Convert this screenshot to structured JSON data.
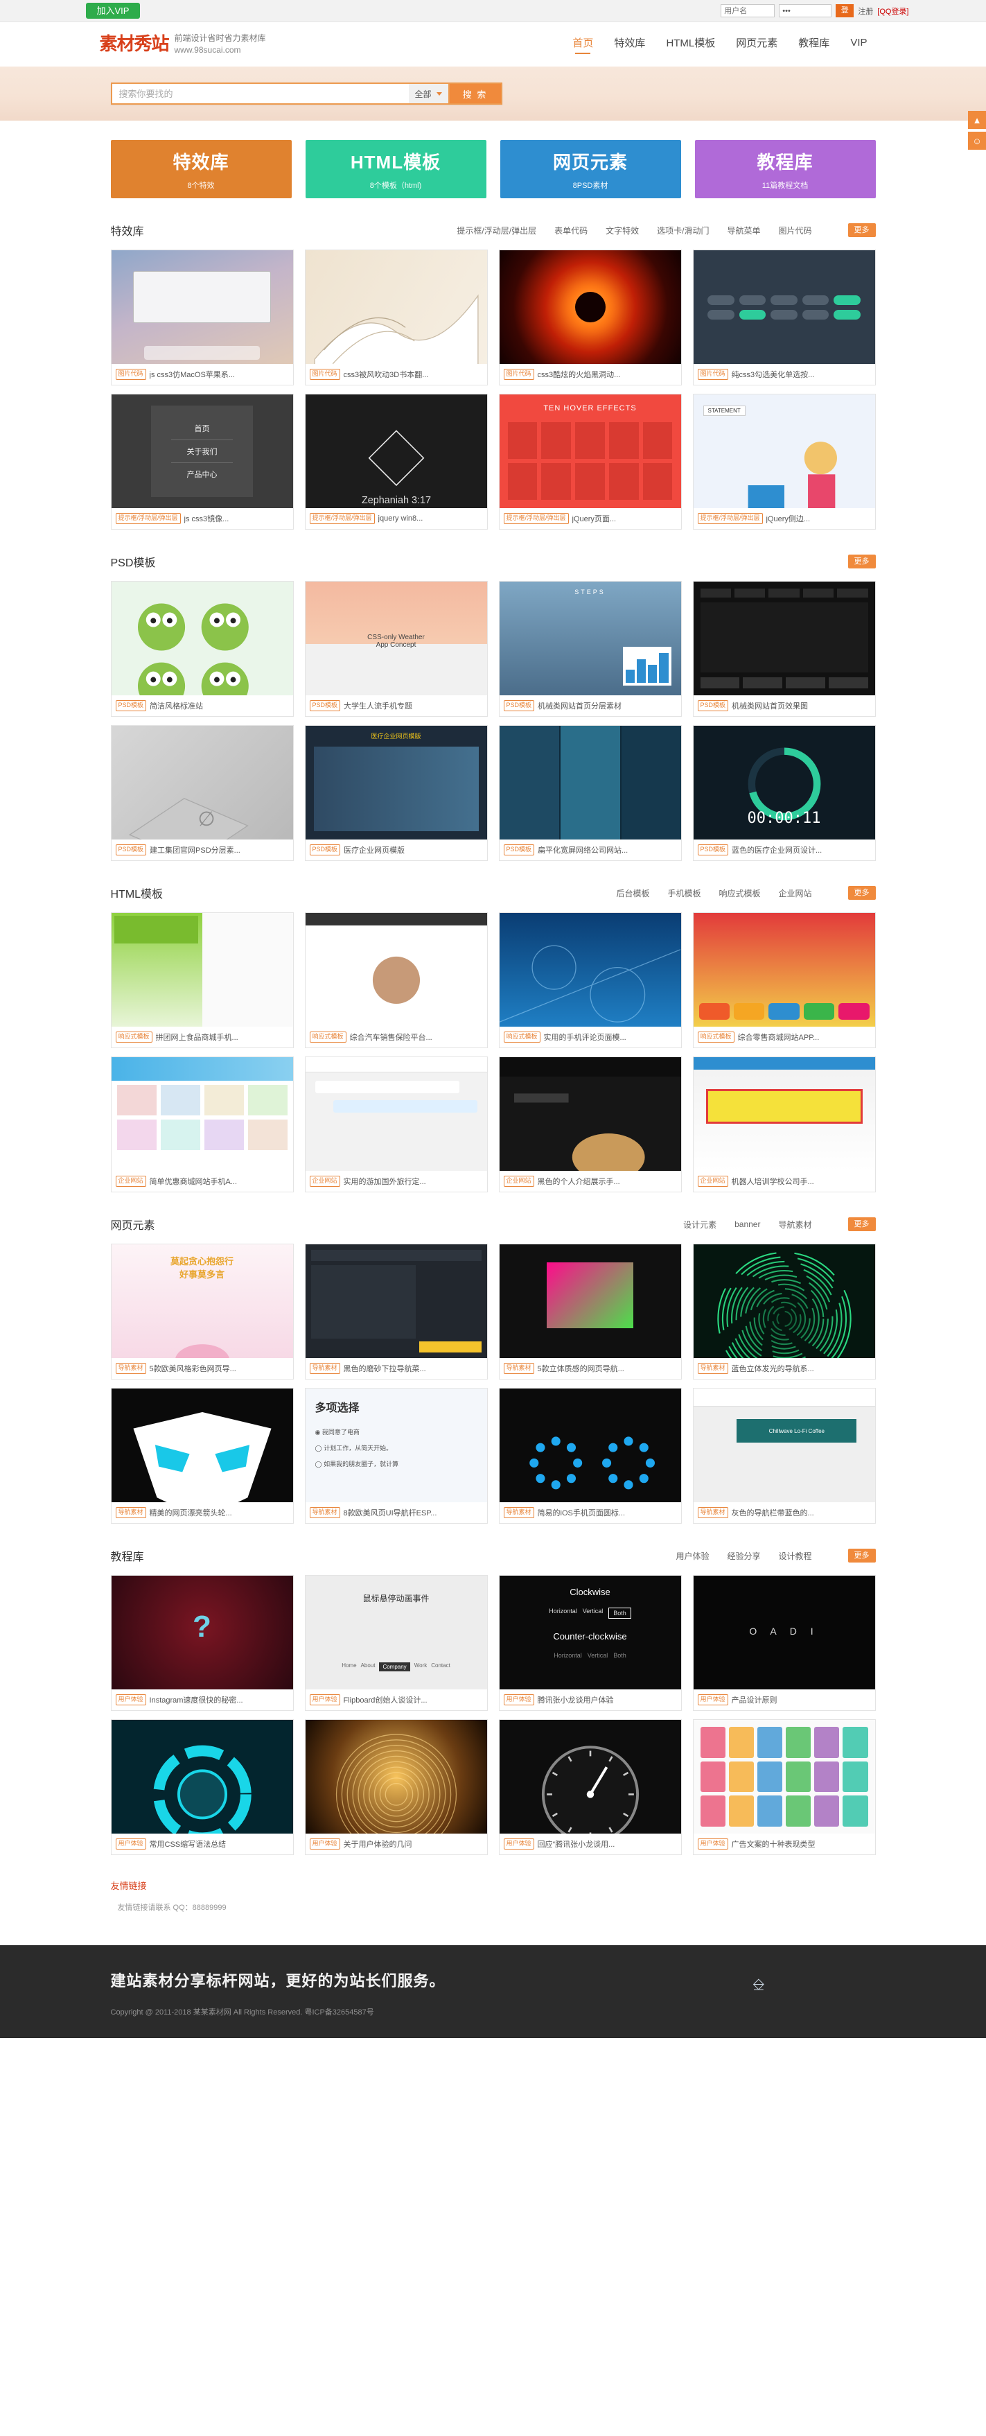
{
  "topbar": {
    "vip_label": "加入VIP",
    "username_placeholder": "用户名",
    "password_value": "•••",
    "login_label": "登",
    "register_label": "注册",
    "qq_login_label": "[QQ登录]"
  },
  "header": {
    "logo_text": "素材秀站",
    "tagline": "前端设计省时省力素材库",
    "site_url": "www.98sucai.com",
    "nav": [
      {
        "label": "首页",
        "active": true
      },
      {
        "label": "特效库",
        "active": false
      },
      {
        "label": "HTML模板",
        "active": false
      },
      {
        "label": "网页元素",
        "active": false
      },
      {
        "label": "教程库",
        "active": false
      },
      {
        "label": "VIP",
        "active": false
      }
    ]
  },
  "search": {
    "placeholder": "搜索你要找的",
    "value": "",
    "scope": "全部",
    "button_label": "搜 索"
  },
  "cards": [
    {
      "title": "特效库",
      "sub": "8个特效",
      "color": "#e0822f"
    },
    {
      "title": "HTML模板",
      "sub": "8个模板（html)",
      "color": "#2ecc9b"
    },
    {
      "title": "网页元素",
      "sub": "8PSD素材",
      "color": "#2e8ed0"
    },
    {
      "title": "教程库",
      "sub": "11篇教程文档",
      "color": "#b06ad8"
    }
  ],
  "sections": [
    {
      "title": "特效库",
      "tabs": [
        "提示框/浮动层/弹出层",
        "表单代码",
        "文字特效",
        "选项卡/滑动门",
        "导航菜单",
        "图片代码"
      ],
      "more": "更多",
      "rows": [
        [
          {
            "tag": "图片代码",
            "title": "js css3仿MacOS苹果系...",
            "art": "mac"
          },
          {
            "tag": "图片代码",
            "title": "css3被风吹动3D书本翻...",
            "art": "book"
          },
          {
            "tag": "图片代码",
            "title": "css3酷炫的火焰黑洞动...",
            "art": "flame"
          },
          {
            "tag": "图片代码",
            "title": "纯css3勾选美化单选按...",
            "art": "toggle"
          }
        ],
        [
          {
            "tag": "提示框/浮动层/弹出层",
            "title": "js css3镜像...",
            "art": "menu"
          },
          {
            "tag": "提示框/浮动层/弹出层",
            "title": "jquery win8...",
            "art": "dark"
          },
          {
            "tag": "提示框/浮动层/弹出层",
            "title": "jQuery页面...",
            "art": "hover"
          },
          {
            "tag": "提示框/浮动层/弹出层",
            "title": "jQuery侧边...",
            "art": "illus"
          }
        ]
      ]
    },
    {
      "title": "PSD模板",
      "tabs": [],
      "more": "更多",
      "rows": [
        [
          {
            "tag": "PSD模板",
            "title": "简洁风格标准站",
            "art": "frog"
          },
          {
            "tag": "PSD模板",
            "title": "大学生人流手机专题",
            "art": "weather"
          },
          {
            "tag": "PSD模板",
            "title": "机械类网站首页分层素材",
            "art": "steps"
          },
          {
            "tag": "PSD模板",
            "title": "机械类网站首页效果图",
            "art": "blackui"
          }
        ],
        [
          {
            "tag": "PSD模板",
            "title": "建工集团官网PSD分层素...",
            "art": "grey3d"
          },
          {
            "tag": "PSD模板",
            "title": "医疗企业网页模版",
            "art": "medical"
          },
          {
            "tag": "PSD模板",
            "title": "扁平化宽屏网络公司网站...",
            "art": "flatweb"
          },
          {
            "tag": "PSD模板",
            "title": "蓝色的医疗企业网页设计...",
            "art": "timer"
          }
        ]
      ]
    },
    {
      "title": "HTML模板",
      "tabs": [
        "后台模板",
        "手机模板",
        "响应式模板",
        "企业网站"
      ],
      "more": "更多",
      "rows": [
        [
          {
            "tag": "响应式模板",
            "title": "拼团网上食品商城手机...",
            "art": "food"
          },
          {
            "tag": "响应式模板",
            "title": "综合汽车销售保险平台...",
            "art": "person"
          },
          {
            "tag": "响应式模板",
            "title": "实用的手机评论页面模...",
            "art": "bluetech"
          },
          {
            "tag": "响应式模板",
            "title": "综合零售商城网站APP...",
            "art": "shop"
          }
        ],
        [
          {
            "tag": "企业网站",
            "title": "简单优惠商城网站手机A...",
            "art": "mall"
          },
          {
            "tag": "企业网站",
            "title": "实用的游加国外旅行定...",
            "art": "chat"
          },
          {
            "tag": "企业网站",
            "title": "黑色的个人介绍展示手...",
            "art": "darkperson"
          },
          {
            "tag": "企业网站",
            "title": "机器人培训学校公司手...",
            "art": "promo"
          }
        ]
      ]
    },
    {
      "title": "网页元素",
      "tabs": [
        "设计元素",
        "banner",
        "导航素材"
      ],
      "more": "更多",
      "rows": [
        [
          {
            "tag": "导航素材",
            "title": "5款欧美风格彩色网页导...",
            "art": "lotus"
          },
          {
            "tag": "导航素材",
            "title": "黑色的磨砂下拉导航菜...",
            "art": "darkmenu"
          },
          {
            "tag": "导航素材",
            "title": "5款立体质感的网页导航...",
            "art": "pinkcube"
          },
          {
            "tag": "导航素材",
            "title": "蓝色立体发光的导航系...",
            "art": "spiral"
          }
        ],
        [
          {
            "tag": "导航素材",
            "title": "精美的网页漂亮箭头轮...",
            "art": "blackmask"
          },
          {
            "tag": "导航素材",
            "title": "8款欧美风页UI导航杆ESP...",
            "art": "choice"
          },
          {
            "tag": "导航素材",
            "title": "简易的iOS手机页面圆标...",
            "art": "dots"
          },
          {
            "tag": "导航素材",
            "title": "灰色的导航栏带蓝色的...",
            "art": "coffee"
          }
        ]
      ]
    },
    {
      "title": "教程库",
      "tabs": [
        "用户体验",
        "经验分享",
        "设计教程"
      ],
      "more": "更多",
      "rows": [
        [
          {
            "tag": "用户体验",
            "title": "Instagram速度很快的秘密...",
            "art": "question"
          },
          {
            "tag": "用户体验",
            "title": "Flipboard创始人谈设计...",
            "art": "hovermenu"
          },
          {
            "tag": "用户体验",
            "title": "腾讯张小龙谈用户体验",
            "art": "clockwise"
          },
          {
            "tag": "用户体验",
            "title": "产品设计原则",
            "art": "oadi"
          }
        ],
        [
          {
            "tag": "用户体验",
            "title": "常用CSS缩写语法总结",
            "art": "cyanring"
          },
          {
            "tag": "用户体验",
            "title": "关于用户体验的几问",
            "art": "goldball"
          },
          {
            "tag": "用户体验",
            "title": "回应“腾讯张小龙谈用...",
            "art": "gauge"
          },
          {
            "tag": "用户体验",
            "title": "广告文案的十种表现类型",
            "art": "icongrid"
          }
        ]
      ]
    }
  ],
  "friend_links": {
    "title": "友情链接",
    "note": "友情链接请联系 QQ：88889999"
  },
  "footer": {
    "slogan": "建站素材分享标杆网站，更好的为站长们服务。",
    "copyright": "Copyright @ 2011-2018 某某素材网 All Rights Reserved. 粤ICP备32654587号"
  },
  "rail": [
    {
      "icon": "▲",
      "name": "back-to-top"
    },
    {
      "icon": "☻",
      "name": "contact"
    }
  ]
}
